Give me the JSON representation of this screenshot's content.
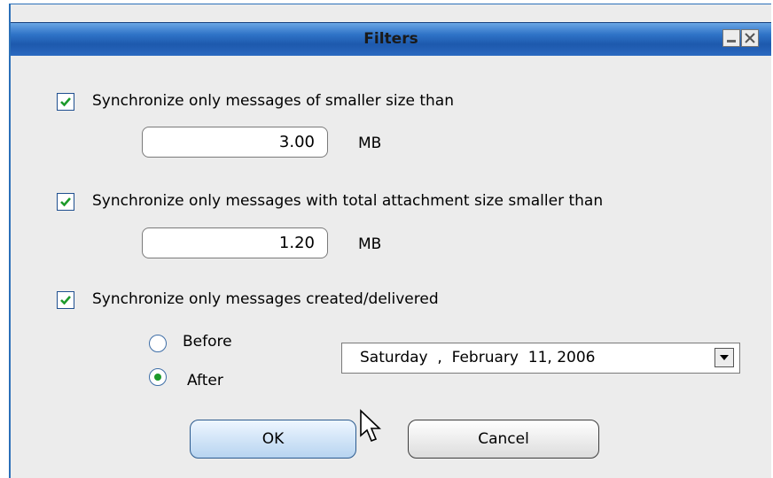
{
  "window": {
    "title": "Filters",
    "minimize_icon": "minimize-icon",
    "close_icon": "close-icon"
  },
  "size_filter": {
    "checked": true,
    "label": "Synchronize only messages of smaller size than",
    "value": "3.00",
    "unit": "MB"
  },
  "attachment_filter": {
    "checked": true,
    "label": "Synchronize only messages with total attachment size smaller than",
    "value": "1.20",
    "unit": "MB"
  },
  "date_filter": {
    "checked": true,
    "label": "Synchronize only messages created/delivered",
    "options": [
      {
        "label": "Before",
        "selected": false
      },
      {
        "label": "After",
        "selected": true
      }
    ],
    "date_value": "Saturday  ,  February  11, 2006"
  },
  "buttons": {
    "ok": "OK",
    "cancel": "Cancel"
  },
  "colors": {
    "titlebar": "#2f73c7",
    "checkmark": "#1d9a2b",
    "dialog_bg": "#ececec"
  }
}
